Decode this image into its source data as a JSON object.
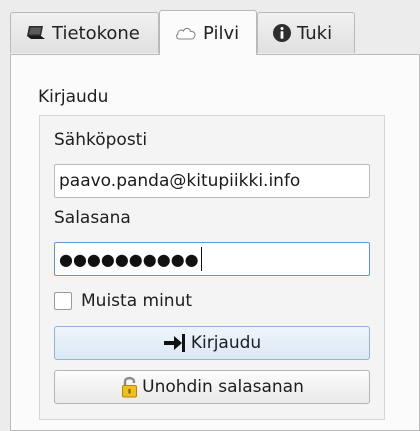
{
  "tabs": [
    {
      "label": "Tietokone",
      "icon": "laptop-icon",
      "active": false
    },
    {
      "label": "Pilvi",
      "icon": "cloud-icon",
      "active": true
    },
    {
      "label": "Tuki",
      "icon": "info-icon",
      "active": false
    }
  ],
  "login": {
    "group_title": "Kirjaudu",
    "email_label": "Sähköposti",
    "email_value": "paavo.panda@kitupiikki.info",
    "password_label": "Salasana",
    "password_mask": "●●●●●●●●●●",
    "remember_label": "Muista minut",
    "remember_checked": false,
    "login_button": "Kirjaudu",
    "forgot_button": "Unohdin salasanan"
  },
  "colors": {
    "focus_border": "#5b9bd5",
    "primary_button": "#dce8f5"
  }
}
